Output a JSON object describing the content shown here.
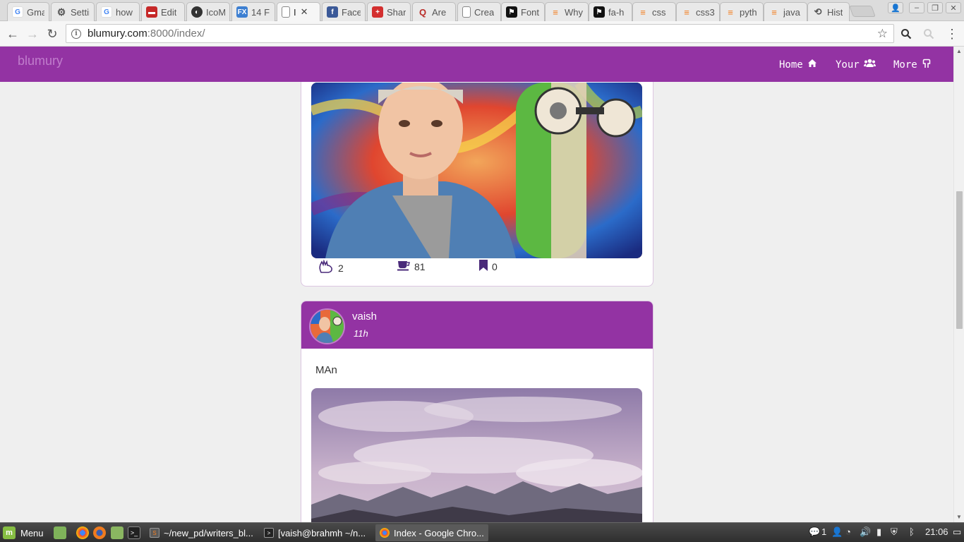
{
  "browser": {
    "tabs": [
      {
        "title": "Gmail",
        "icon": "google-icon"
      },
      {
        "title": "Settings",
        "icon": "gear-icon"
      },
      {
        "title": "how",
        "icon": "google-icon"
      },
      {
        "title": "Edit",
        "icon": "car-icon"
      },
      {
        "title": "IcoMoon",
        "icon": "icomoon-icon"
      },
      {
        "title": "14 F",
        "icon": "fx-icon"
      },
      {
        "title": "I",
        "icon": "page-icon",
        "active": true
      },
      {
        "title": "Face",
        "icon": "facebook-icon"
      },
      {
        "title": "Shar",
        "icon": "red-cross-icon"
      },
      {
        "title": "Are",
        "icon": "quora-icon"
      },
      {
        "title": "Crea",
        "icon": "page-icon"
      },
      {
        "title": "Font",
        "icon": "flag-icon"
      },
      {
        "title": "Why",
        "icon": "stackoverflow-icon"
      },
      {
        "title": "fa-h",
        "icon": "flag-icon"
      },
      {
        "title": "css",
        "icon": "stackoverflow-icon"
      },
      {
        "title": "css3",
        "icon": "stackoverflow-icon"
      },
      {
        "title": "pyth",
        "icon": "stackoverflow-icon"
      },
      {
        "title": "java",
        "icon": "stackoverflow-icon"
      },
      {
        "title": "Hist",
        "icon": "history-icon"
      }
    ],
    "url_host": "blumury.com",
    "url_rest": ":8000/index/"
  },
  "site": {
    "brand": "blumury",
    "nav": [
      {
        "label": "Home",
        "icon": "home-icon"
      },
      {
        "label": "Your",
        "icon": "users-icon"
      },
      {
        "label": "More",
        "icon": "hand-pointing-icon"
      }
    ]
  },
  "posts": [
    {
      "image": "boy-with-skateboard-graffiti",
      "stats": {
        "claps": "2",
        "coffee": "81",
        "bookmarks": "0"
      }
    },
    {
      "author": "vaish",
      "time": "11h",
      "text": "MAn",
      "image": "cloudy-sky-mountains"
    }
  ],
  "taskbar": {
    "menu_label": "Menu",
    "windows": [
      {
        "label": "~/new_pd/writers_bl...",
        "icon": "sublime-icon"
      },
      {
        "label": "[vaish@brahmh ~/n...",
        "icon": "terminal-icon"
      },
      {
        "label": "Index - Google Chro...",
        "icon": "chrome-icon",
        "active": true
      }
    ],
    "notification_count": "1",
    "clock": "21:06"
  },
  "colors": {
    "brand_purple": "#9333a3",
    "brand_light": "#c07dcc",
    "page_bg": "#efefef"
  }
}
